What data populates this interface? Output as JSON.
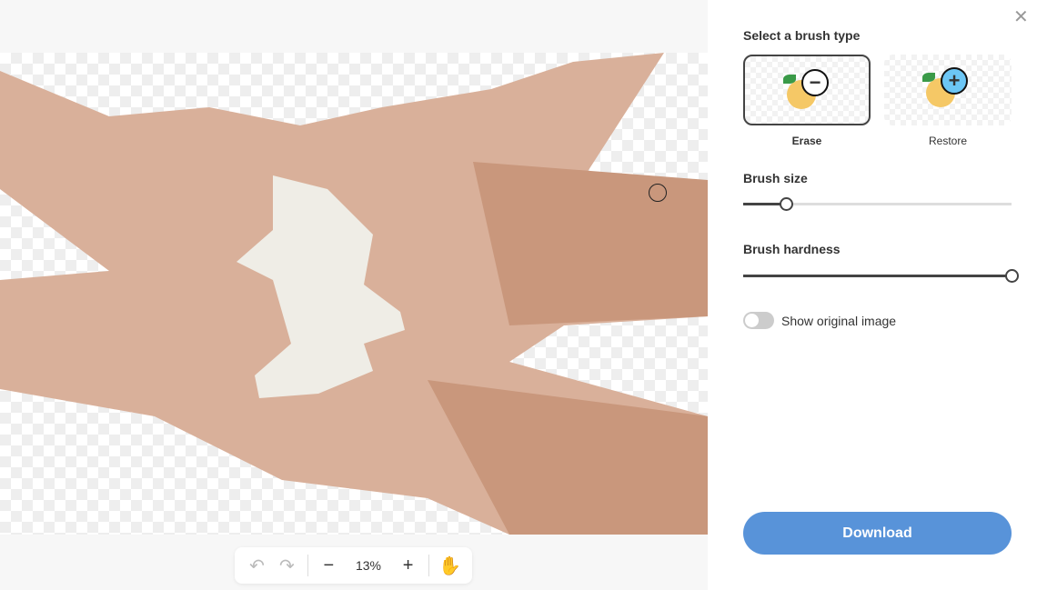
{
  "canvas": {
    "zoom": "13%",
    "icons": [
      "undo-icon",
      "redo-icon",
      "zoom-out-icon",
      "zoom-in-icon",
      "hand-icon"
    ]
  },
  "panel": {
    "brush_type_title": "Select a brush type",
    "brushes": [
      {
        "label": "Erase",
        "selected": true
      },
      {
        "label": "Restore",
        "selected": false
      }
    ],
    "brush_size_label": "Brush size",
    "brush_size_percent": 16,
    "brush_hardness_label": "Brush hardness",
    "brush_hardness_percent": 100,
    "show_original_label": "Show original image",
    "show_original": false,
    "download_label": "Download",
    "accent": "#5893d9"
  }
}
